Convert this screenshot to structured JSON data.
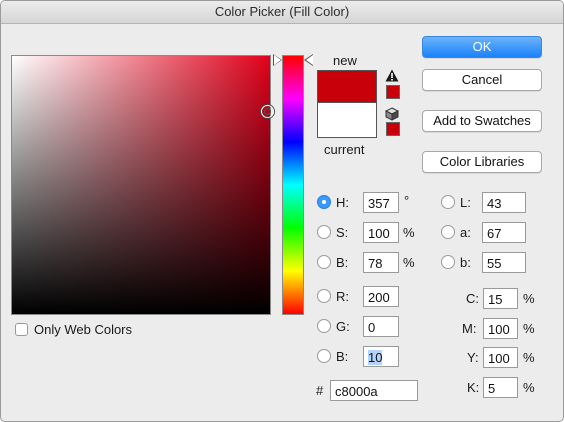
{
  "window": {
    "title": "Color Picker (Fill Color)"
  },
  "buttons": {
    "ok": "OK",
    "cancel": "Cancel",
    "add_to_swatches": "Add to Swatches",
    "color_libraries": "Color Libraries"
  },
  "swatch": {
    "new_label": "new",
    "current_label": "current",
    "new_color": "#c8000a",
    "current_color": "#ffffff"
  },
  "only_web_colors": {
    "label": "Only Web Colors",
    "checked": false
  },
  "hsb": {
    "h": {
      "label": "H:",
      "value": "357",
      "unit": "°",
      "selected": true
    },
    "s": {
      "label": "S:",
      "value": "100",
      "unit": "%"
    },
    "b": {
      "label": "B:",
      "value": "78",
      "unit": "%"
    }
  },
  "rgb": {
    "r": {
      "label": "R:",
      "value": "200"
    },
    "g": {
      "label": "G:",
      "value": "0"
    },
    "b": {
      "label": "B:",
      "value": "10"
    }
  },
  "lab": {
    "l": {
      "label": "L:",
      "value": "43"
    },
    "a": {
      "label": "a:",
      "value": "67"
    },
    "b": {
      "label": "b:",
      "value": "55"
    }
  },
  "cmyk": {
    "c": {
      "label": "C:",
      "value": "15",
      "unit": "%"
    },
    "m": {
      "label": "M:",
      "value": "100",
      "unit": "%"
    },
    "y": {
      "label": "Y:",
      "value": "100",
      "unit": "%"
    },
    "k": {
      "label": "K:",
      "value": "5",
      "unit": "%"
    }
  },
  "hex": {
    "label": "#",
    "value": "c8000a"
  },
  "icons": {
    "gamut_warning": "warning-icon",
    "web_safe": "cube-icon"
  }
}
